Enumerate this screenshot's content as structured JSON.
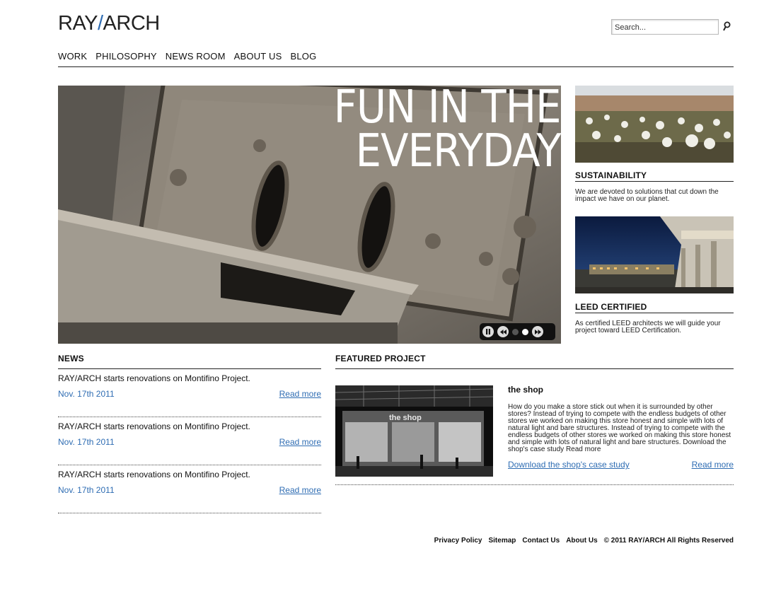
{
  "header": {
    "logo_left": "RAY",
    "logo_slash": "/",
    "logo_right": "ARCH",
    "search_placeholder": "Search..."
  },
  "nav": {
    "items": [
      "WORK",
      "PHILOSOPHY",
      "NEWS ROOM",
      "ABOUT US",
      "BLOG"
    ]
  },
  "hero": {
    "title_line1": "FUN IN THE",
    "title_line2": "EVERYDAY",
    "slides_count": 2,
    "active_slide": 2
  },
  "sidebar": {
    "items": [
      {
        "title": "SUSTAINABILITY",
        "text": "We are devoted to solutions that cut down the impact we have on our planet."
      },
      {
        "title": "LEED CERTIFIED",
        "text": "As certified LEED architects we will guide your project toward LEED Certification."
      }
    ]
  },
  "news": {
    "heading": "NEWS",
    "items": [
      {
        "headline": "RAY/ARCH starts renovations on Montifino Project.",
        "date": "Nov. 17th 2011",
        "more": "Read more"
      },
      {
        "headline": "RAY/ARCH starts renovations on Montifino Project.",
        "date": "Nov. 17th 2011",
        "more": "Read more"
      },
      {
        "headline": "RAY/ARCH starts renovations on Montifino Project.",
        "date": "Nov. 17th 2011",
        "more": "Read more"
      }
    ]
  },
  "featured": {
    "heading": "FEATURED PROJECT",
    "title": "the shop",
    "sign_text": "the shop",
    "description": "How do you make a store stick out when it is surrounded by other stores? Instead of trying to compete with the endless budgets of other stores we worked on making this store honest and simple with lots of natural light and bare structures. Instead of trying to compete with the endless budgets of other stores we worked on making this store honest and simple with lots of natural light and bare structures. Download the shop's case study Read more",
    "download_link": "Download the shop's case study",
    "more": "Read more"
  },
  "footer": {
    "links": [
      "Privacy Policy",
      "Sitemap",
      "Contact Us",
      "About Us"
    ],
    "copyright": "© 2011 RAY/ARCH All Rights Reserved"
  },
  "colors": {
    "link": "#2f6db3",
    "text": "#111111",
    "background": "#ffffff"
  }
}
